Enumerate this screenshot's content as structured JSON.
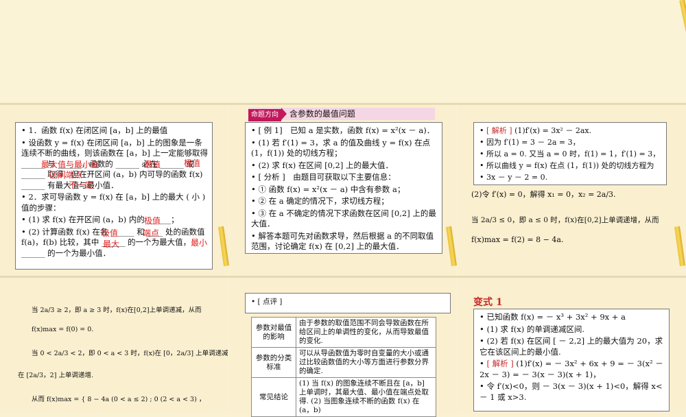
{
  "slide1": {
    "items": [
      "1．函数 f(x) 在闭区间 [a，b] 上的最值",
      "设函数 y = f(x) 在闭区间 [a，b] 上的图象是一条连续不断的曲线，则该函数在 [a，b] 上一定能够取得 ______ 与 ______，函数的 ______ 必在 ______ 或 ______ 取得．但在开区间 (a，b) 内可导的函数 f(x) ______ 有最大值与最小值．",
      "2．求可导函数 y = f(x) 在 [a，b] 上的最大 ( 小 ) 值的步骤：",
      "(1) 求 f(x) 在开区间 (a，b) 内的 ______；",
      "(2) 计算函数 f(x) 在各 ______ 和 ____ 处的函数值 f(a)，f(b) 比较，其中 ______ 的一个为最大值，______ 的一个为最小值．"
    ],
    "overlays": {
      "max_min": "最大值与最小值",
      "zuizhi": "最值",
      "jizhi1": "极值",
      "interval_end": "区间端点",
      "not_necessarily": "不一定",
      "jizhi2": "极值",
      "jizhi3": "极值",
      "endpoint": "端点",
      "biggest": "最大",
      "smallest": "最小"
    }
  },
  "slide2": {
    "tag_label": "命题方向",
    "tag_title": "含参数的最值问题",
    "items": [
      "[ 例 1]　已知 a 是实数，函数 f(x) = x²(x － a)．",
      "(1) 若 f′(1) = 3，求 a 的值及曲线 y = f(x) 在点 (1，f(1)) 处的切线方程；",
      "(2) 求 f(x) 在区间 [0,2] 上的最大值．",
      "[ 分析 ]　由题目可获取以下主要信息：",
      "① 函数 f(x) = x²(x － a) 中含有参数 a；",
      "② 在 a 确定的情况下，求切线方程；",
      "③ 在 a 不确定的情况下求函数在区间 [0,2] 上的最大值．",
      "解答本题可先对函数求导，然后根据 a 的不同取值范围，讨论确定 f(x) 在 [0,2] 上的最大值．"
    ]
  },
  "slide3": {
    "jiexi_label": "[ 解析 ]",
    "items": [
      "(1)f′(x) = 3x² － 2ax.",
      "因为 f′(1) = 3 － 2a = 3，",
      "所以 a = 0. 又当 a = 0 时，f(1) = 1，f′(1) = 3，",
      "所以曲线 y = f(x) 在点 (1，f(1)) 处的切线方程为",
      "3x － y － 2 = 0."
    ],
    "math": [
      "(2)令 f′(x) = 0，解得 x₁ = 0，x₂ = 2a/3.",
      "当 2a/3 ≤ 0，即 a ≤ 0 时，f(x)在[0,2]上单调递增，从而",
      "f(x)max = f(2) = 8 − 4a."
    ]
  },
  "slide4": {
    "lines": [
      "当 2a/3 ≥ 2，即 a ≥ 3 时，f(x)在[0,2]上单调递减，从而",
      "f(x)max = f(0) = 0.",
      "当 0 < 2a/3 < 2，即 0 < a < 3 时，f(x)在 [0，2a/3] 上单调递减，",
      "在 [2a/3，2] 上单调递增.",
      "从而 f(x)max = { 8 − 4a (0 < a ≤ 2) ; 0 (2 < a < 3) ，"
    ]
  },
  "slide5": {
    "header": "[ 点评 ]",
    "rows": [
      {
        "h": "参数对最值的影响",
        "c": "由于参数的取值范围不同会导致函数在所给区间上的单调性的变化，从而导致最值的变化."
      },
      {
        "h": "参数的分类标准",
        "c": "可以从导函数值为零时自变量的大小或通过比较函数值的大小等方面进行参数分界的确定."
      },
      {
        "h": "常见结论",
        "c": "(1) 当 f(x) 的图象连续不断且在 [a，b] 上单调时，其最大值、最小值在端点处取得. (2) 当图象连续不断的函数 f(x) 在 (a，b)"
      }
    ]
  },
  "slide6": {
    "title": "变式 1",
    "items": [
      "已知函数 f(x) = － x³ + 3x² + 9x + a",
      "(1) 求 f(x) 的单调递减区间.",
      "(2) 若 f(x) 在区间 [ － 2,2] 上的最大值为 20，求它在该区间上的最小值.",
      "(1)f′(x) = － 3x² + 6x + 9 = － 3(x² － 2x － 3) = － 3(x － 3)(x + 1)，",
      "令 f′(x)<0，则 － 3(x － 3)(x + 1)<0，解得 x< － 1 或 x>3."
    ],
    "jiexi_label": "[ 解析 ]"
  }
}
